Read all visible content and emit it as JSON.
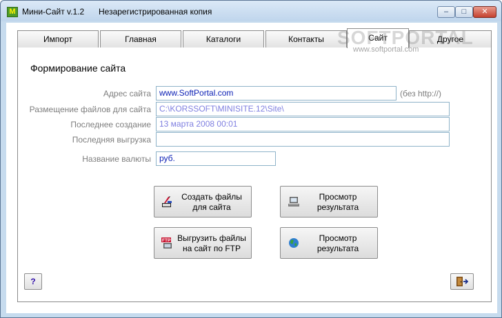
{
  "window": {
    "title": "Мини-Сайт v.1.2",
    "subtitle": "Незарегистрированная копия",
    "app_icon_letter": "M",
    "controls": {
      "minimize": "–",
      "maximize": "□",
      "close": "✕"
    }
  },
  "tabs": [
    {
      "label": "Импорт"
    },
    {
      "label": "Главная"
    },
    {
      "label": "Каталоги"
    },
    {
      "label": "Контакты"
    },
    {
      "label": "Сайт",
      "active": true
    },
    {
      "label": "Другое"
    }
  ],
  "watermark": {
    "logo": "SOFTPORTAL",
    "url": "www.softportal.com"
  },
  "site": {
    "section_title": "Формирование сайта",
    "fields": {
      "address": {
        "label": "Адрес сайта",
        "value": "www.SoftPortal.com",
        "hint": "(без http://)"
      },
      "path": {
        "label": "Размещение файлов для сайта",
        "value": "C:\\KORSSOFT\\MINISITE.12\\Site\\"
      },
      "last_created": {
        "label": "Последнее создание",
        "value": "13 марта 2008 00:01"
      },
      "last_upload": {
        "label": "Последняя выгрузка",
        "value": ""
      },
      "currency": {
        "label": "Название валюты",
        "value": "руб."
      }
    },
    "buttons": {
      "create": "Создать файлы для сайта",
      "preview_local": "Просмотр результата",
      "upload_ftp": "Выгрузить файлы на сайт по FTP",
      "preview_web": "Просмотр результата"
    }
  },
  "footer": {
    "help_label": "?"
  },
  "colors": {
    "window_frame": "#c6dbee",
    "field_border": "#8eb3c9",
    "dim_value": "#7f7fe0",
    "strong_value": "#0a1eb4"
  }
}
